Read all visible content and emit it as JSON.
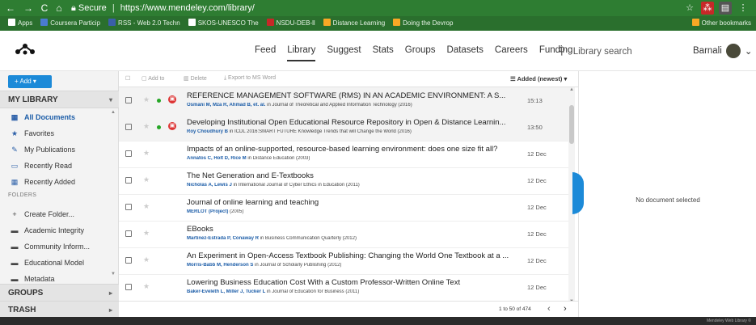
{
  "browser": {
    "secure_label": "Secure",
    "url": "https://www.mendeley.com/library/",
    "bookmarks": [
      {
        "label": "Apps",
        "color": "#ffffff"
      },
      {
        "label": "Coursera Particip",
        "color": "#4a7bd0"
      },
      {
        "label": "RSS - Web 2.0 Techn",
        "color": "#3a5fa8"
      },
      {
        "label": "SKOS-UNESCO The",
        "color": "#ffffff"
      },
      {
        "label": "NSDU-DEB-ll",
        "color": "#c62828"
      },
      {
        "label": "Distance Learning",
        "color": "#f9a825"
      },
      {
        "label": "Doing the Devrop",
        "color": "#f9a825"
      }
    ],
    "other_bookmarks": "Other bookmarks"
  },
  "header": {
    "logo": "ꟽ⁂",
    "nav": [
      "Feed",
      "Library",
      "Suggest",
      "Stats",
      "Groups",
      "Datasets",
      "Careers",
      "Funding"
    ],
    "active_nav": "Library",
    "search_placeholder": "Library search",
    "user_name": "Barnali"
  },
  "sidebar": {
    "add_label": "+ Add ▾",
    "my_library": "MY LIBRARY",
    "items": [
      {
        "label": "All Documents",
        "icon": "all-documents-icon",
        "glyph": "▦"
      },
      {
        "label": "Favorites",
        "icon": "star-icon",
        "glyph": "★"
      },
      {
        "label": "My Publications",
        "icon": "publications-icon",
        "glyph": "✎"
      },
      {
        "label": "Recently Read",
        "icon": "book-icon",
        "glyph": "▭"
      },
      {
        "label": "Recently Added",
        "icon": "calendar-icon",
        "glyph": "▦"
      }
    ],
    "folders_label": "FOLDERS",
    "folders": [
      {
        "label": "Create Folder...",
        "glyph": "+"
      },
      {
        "label": "Academic Integrity",
        "glyph": "▬"
      },
      {
        "label": "Community Inform...",
        "glyph": "▬"
      },
      {
        "label": "Educational Model",
        "glyph": "▬"
      },
      {
        "label": "Metadata",
        "glyph": "▬"
      }
    ],
    "groups": "GROUPS",
    "trash": "TRASH"
  },
  "toolbar": {
    "add_to": "Add to",
    "delete": "Delete",
    "export": "Export to MS Word",
    "sort": "Added (newest) ▾"
  },
  "documents": [
    {
      "title": "REFERENCE MANAGEMENT SOFTWARE (RMS) IN AN ACADEMIC ENVIRONMENT: A S...",
      "authors": "Osmani M, Mza R, Ahmad B, et. al.",
      "source": "in Journal of Theoretical and Applied Information Technology (2016)",
      "date": "15:13",
      "unread": true,
      "pdf": true
    },
    {
      "title": "Developing Institutional Open Educational Resource Repository in Open & Distance Learnin...",
      "authors": "Roy Choudhury B",
      "source": "in ICDL 2016:SMART FUTURE Knowledge Trends that will Change the World (2016)",
      "date": "13:50",
      "unread": true,
      "pdf": true
    },
    {
      "title": "Impacts of an online-supported, resource-based learning environment: does one size fit all?",
      "authors": "Annatos C, Holt D, Rice M",
      "source": "in Distance Education (2003)",
      "date": "12 Dec",
      "unread": false,
      "pdf": false
    },
    {
      "title": "The Net Generation and E-Textbooks",
      "authors": "Nicholas A, Lewis J",
      "source": "in International Journal of Cyber Ethics in Education (2011)",
      "date": "12 Dec",
      "unread": false,
      "pdf": false
    },
    {
      "title": "Journal of online learning and teaching",
      "authors": "MERLOT (Project)",
      "source": "(2005)",
      "date": "12 Dec",
      "unread": false,
      "pdf": false
    },
    {
      "title": "EBooks",
      "authors": "Martinez-Estrada P, Conaway R",
      "source": "in Business Communication Quarterly (2012)",
      "date": "12 Dec",
      "unread": false,
      "pdf": false
    },
    {
      "title": "An Experiment in Open-Access Textbook Publishing: Changing the World One Textbook at a ...",
      "authors": "Morris-Babb M, Henderson S",
      "source": "in Journal of Scholarly Publishing (2012)",
      "date": "12 Dec",
      "unread": false,
      "pdf": false
    },
    {
      "title": "Lowering Business Education Cost With a Custom Professor-Written Online Text",
      "authors": "Baker-Eveleth L, Miller J, Tucker L",
      "source": "in Journal of Education for Business (2011)",
      "date": "12 Dec",
      "unread": false,
      "pdf": false
    }
  ],
  "pager": {
    "text": "1 to 50 of 474"
  },
  "detail": {
    "empty_text": "No document selected"
  },
  "footer": {
    "text": "Mendeley Web Library ©"
  }
}
